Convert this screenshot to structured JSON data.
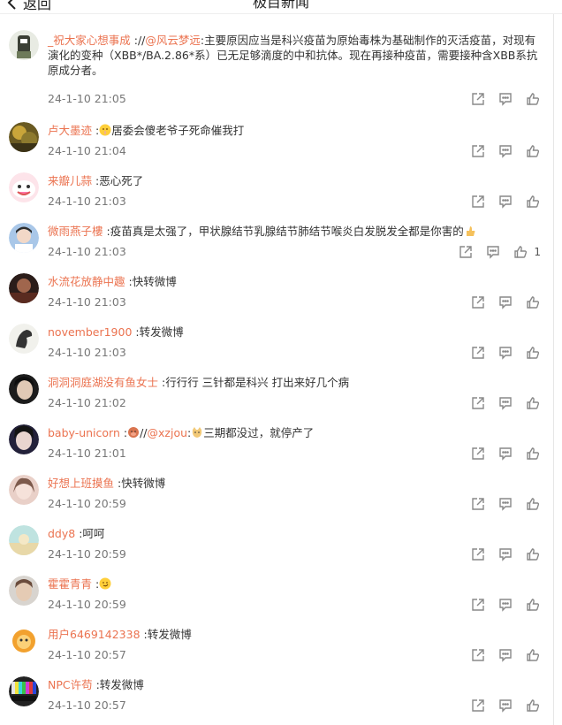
{
  "header": {
    "back_label": "返回",
    "title": "极目新闻"
  },
  "comments": [
    {
      "user": "_祝大家心想事成",
      "parts": [
        {
          "t": " ://",
          "c": "n"
        },
        {
          "t": "@风云梦远",
          "c": "m"
        },
        {
          "t": ":主要原因应当是科兴疫苗为原始毒株为基础制作的灭活疫苗，对现有演化的变种（XBB*/BA.2.86*系）已无足够滴度的中和抗体。现在再接种疫苗，需要接种含XBB系抗原成分者。",
          "c": "n"
        }
      ],
      "time": "24-1-10 21:05",
      "likes": ""
    },
    {
      "user": "卢大墨迹",
      "parts": [
        {
          "t": " :",
          "c": "n"
        },
        {
          "t": "emoji-shh",
          "c": "e"
        },
        {
          "t": "居委会傻老爷子死命催我打",
          "c": "n"
        }
      ],
      "time": "24-1-10 21:04",
      "likes": ""
    },
    {
      "user": "来瓣儿蒜",
      "parts": [
        {
          "t": " :恶心死了",
          "c": "n"
        }
      ],
      "time": "24-1-10 21:03",
      "likes": ""
    },
    {
      "user": "微雨燕子樓",
      "parts": [
        {
          "t": " :疫苗真是太强了，甲状腺结节乳腺结节肺结节喉炎白发脱发全都是你害的",
          "c": "n"
        },
        {
          "t": "emoji-thumb",
          "c": "e"
        }
      ],
      "time": "24-1-10 21:03",
      "likes": "1"
    },
    {
      "user": "水流花放静中趣",
      "parts": [
        {
          "t": " :快转微博",
          "c": "n"
        }
      ],
      "time": "24-1-10 21:03",
      "likes": ""
    },
    {
      "user": "november1900",
      "parts": [
        {
          "t": " :转发微博",
          "c": "n"
        }
      ],
      "time": "24-1-10 21:03",
      "likes": ""
    },
    {
      "user": "洞洞洞庭湖没有鱼女士",
      "parts": [
        {
          "t": " :行行行 三针都是科兴 打出来好几个病",
          "c": "n"
        }
      ],
      "time": "24-1-10 21:02",
      "likes": ""
    },
    {
      "user": "baby-unicorn",
      "parts": [
        {
          "t": " :",
          "c": "n"
        },
        {
          "t": "emoji-pig",
          "c": "e"
        },
        {
          "t": "//",
          "c": "n"
        },
        {
          "t": "@xzjou",
          "c": "m"
        },
        {
          "t": ":",
          "c": "n"
        },
        {
          "t": "emoji-cat",
          "c": "e"
        },
        {
          "t": "三期都没过，就停产了",
          "c": "n"
        }
      ],
      "time": "24-1-10 21:01",
      "likes": ""
    },
    {
      "user": "好想上班摸鱼",
      "parts": [
        {
          "t": " :快转微博",
          "c": "n"
        }
      ],
      "time": "24-1-10 20:59",
      "likes": ""
    },
    {
      "user": "ddy8",
      "parts": [
        {
          "t": " :呵呵",
          "c": "n"
        }
      ],
      "time": "24-1-10 20:59",
      "likes": ""
    },
    {
      "user": "霍霍青青",
      "parts": [
        {
          "t": " :",
          "c": "n"
        },
        {
          "t": "emoji-smirk",
          "c": "e"
        }
      ],
      "time": "24-1-10 20:59",
      "likes": ""
    },
    {
      "user": "用户6469142338",
      "parts": [
        {
          "t": " :转发微博",
          "c": "n"
        }
      ],
      "time": "24-1-10 20:57",
      "likes": ""
    },
    {
      "user": "NPC许苟",
      "parts": [
        {
          "t": " :转发微博",
          "c": "n"
        }
      ],
      "time": "24-1-10 20:57",
      "likes": ""
    }
  ],
  "colors": {
    "username": "#eb7350",
    "time": "#777777",
    "icon": "#888888"
  }
}
